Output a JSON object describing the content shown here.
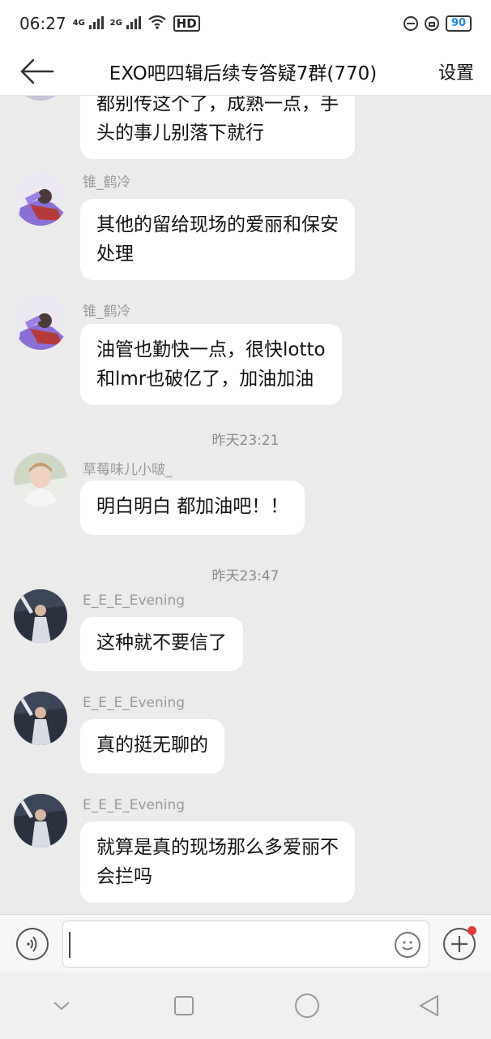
{
  "status_bar": {
    "time": "06:27",
    "signal1": "4G",
    "signal2": "2G",
    "wifi_label": "HD",
    "battery": "90",
    "icons": [
      "signal-icon",
      "signal-icon",
      "wifi-icon",
      "hd-icon",
      "dnd-icon",
      "lock-icon",
      "battery-icon"
    ]
  },
  "header": {
    "back_icon": "back-arrow-icon",
    "title": "EXO吧四辑后续专答疑7群(770)",
    "settings_label": "设置"
  },
  "messages": [
    {
      "type": "message",
      "sender": "",
      "text": "都别传这个了，成熟一点，手\n头的事儿别落下就行",
      "avatar": "avatar-purple"
    },
    {
      "type": "message",
      "sender": "锥_鹤冷",
      "text": "其他的留给现场的爱丽和保安\n处理",
      "avatar": "avatar-purple"
    },
    {
      "type": "message",
      "sender": "锥_鹤冷",
      "text": "油管也勤快一点，很快lotto\n和lmr也破亿了，加油加油",
      "avatar": "avatar-purple"
    },
    {
      "type": "timestamp",
      "text": "昨天23:21"
    },
    {
      "type": "message",
      "sender": "草莓味儿小啵_",
      "text": "明白明白 都加油吧！！",
      "avatar": "avatar-light"
    },
    {
      "type": "timestamp",
      "text": "昨天23:47"
    },
    {
      "type": "message",
      "sender": "E_E_E_Evening",
      "text": "这种就不要信了",
      "avatar": "avatar-stage"
    },
    {
      "type": "message",
      "sender": "E_E_E_Evening",
      "text": "真的挺无聊的",
      "avatar": "avatar-stage"
    },
    {
      "type": "message",
      "sender": "E_E_E_Evening",
      "text": "就算是真的现场那么多爱丽不\n会拦吗",
      "avatar": "avatar-stage"
    }
  ],
  "input_bar": {
    "voice_icon": "voice-icon",
    "input_value": "",
    "emoji_icon": "emoji-icon",
    "plus_icon": "plus-icon",
    "has_notification_dot": true
  },
  "nav_bar": {
    "icons": [
      "collapse-icon",
      "recents-icon",
      "home-icon",
      "back-icon"
    ]
  },
  "colors": {
    "background": "#ebebeb",
    "bubble": "#ffffff",
    "accent_battery": "#1e88e5",
    "notification_dot": "#e53935"
  }
}
